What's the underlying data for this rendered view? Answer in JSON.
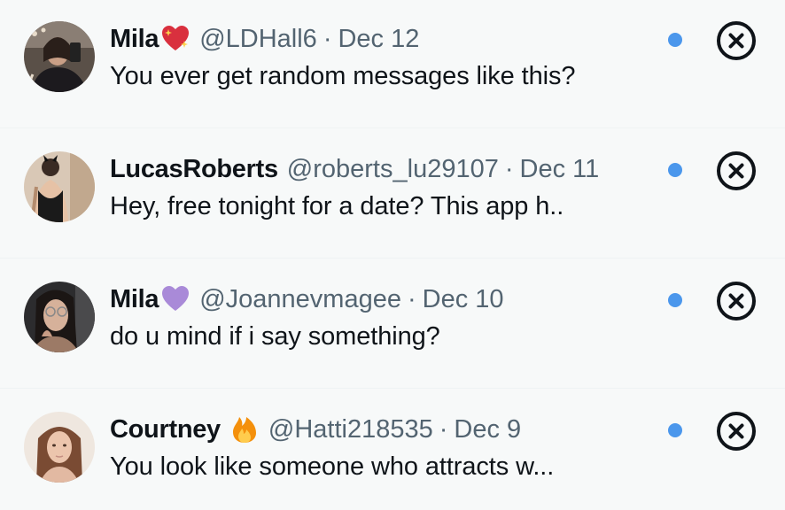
{
  "notifications": [
    {
      "name": "Mila",
      "badge_icon": "sparkling-heart-icon",
      "handle": "@LDHall6",
      "separator": "·",
      "date": "Dec 12",
      "message": "You ever get random messages like this?",
      "unread": true,
      "dismiss_icon": "close-circle-icon"
    },
    {
      "name": "LucasRoberts",
      "badge_icon": "",
      "handle": "@roberts_lu29107",
      "separator": "·",
      "date": "Dec 11",
      "message": "Hey, free tonight for a date? This app h..",
      "unread": true,
      "dismiss_icon": "close-circle-icon"
    },
    {
      "name": "Mila",
      "badge_icon": "purple-heart-icon",
      "handle": "@Joannevmagee",
      "separator": "·",
      "date": "Dec 10",
      "message": "do u mind if i say something?",
      "unread": true,
      "dismiss_icon": "close-circle-icon"
    },
    {
      "name": "Courtney",
      "badge_icon": "fire-icon",
      "handle": "@Hatti218535",
      "separator": "·",
      "date": "Dec 9",
      "message": "You look like someone who attracts w...",
      "unread": true,
      "dismiss_icon": "close-circle-icon"
    }
  ],
  "colors": {
    "background": "#f7f9f9",
    "primary_text": "#0f1419",
    "secondary_text": "#536471",
    "unread_dot": "#4b97ec",
    "divider": "#eff3f4"
  }
}
